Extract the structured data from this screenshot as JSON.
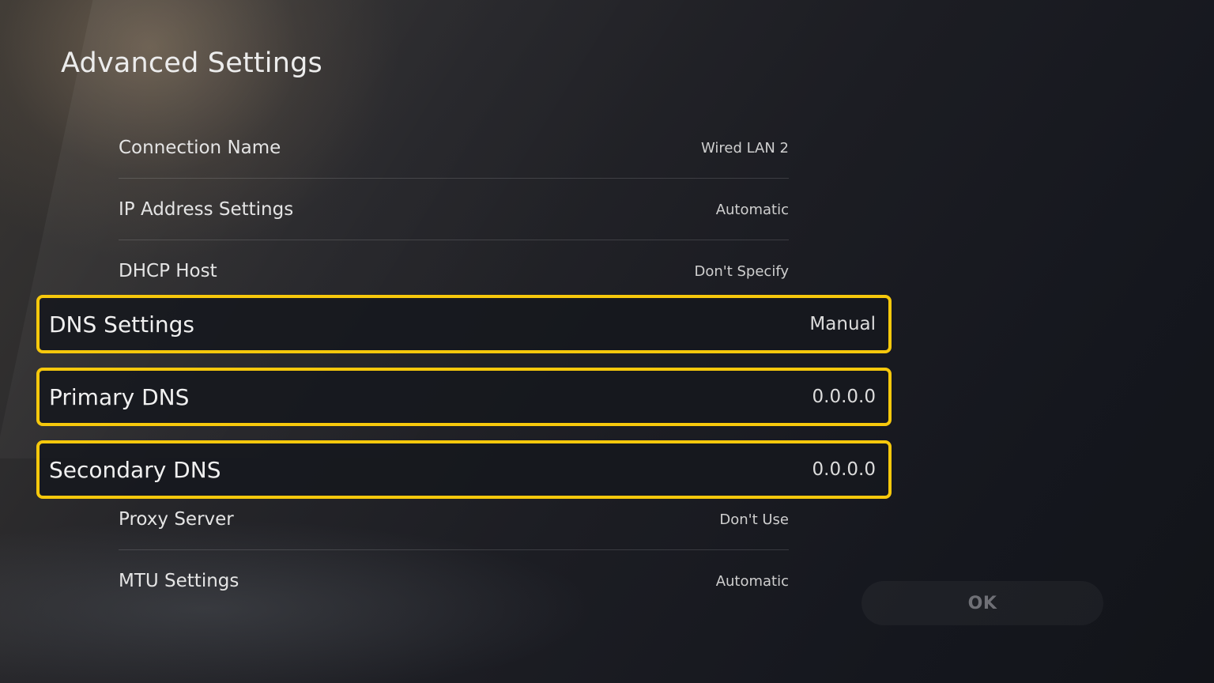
{
  "page": {
    "title": "Advanced Settings"
  },
  "settings": [
    {
      "label": "Connection Name",
      "value": "Wired LAN 2"
    },
    {
      "label": "IP Address Settings",
      "value": "Automatic"
    },
    {
      "label": "DHCP Host",
      "value": "Don't Specify"
    },
    {
      "label": "DNS Settings",
      "value": "Manual"
    },
    {
      "label": "Primary DNS",
      "value": "0.0.0.0"
    },
    {
      "label": "Secondary DNS",
      "value": "0.0.0.0"
    },
    {
      "label": "Proxy Server",
      "value": "Don't Use"
    },
    {
      "label": "MTU Settings",
      "value": "Automatic"
    }
  ],
  "actions": {
    "ok_label": "OK"
  },
  "colors": {
    "highlight": "#f6c80c",
    "background": "#1c1d23",
    "disabled_text": "#6f7076"
  }
}
